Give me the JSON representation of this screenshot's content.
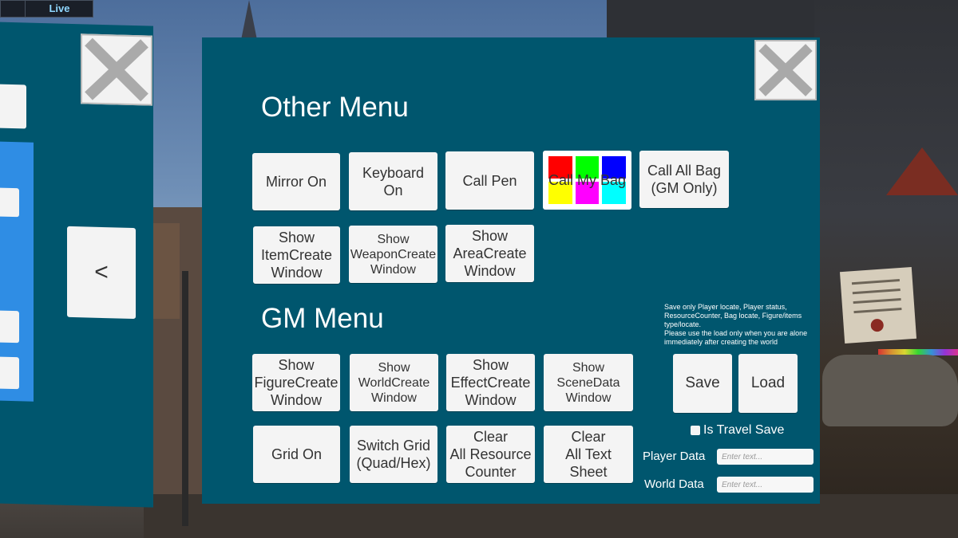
{
  "topbar": {
    "live_label": "Live"
  },
  "left_panel": {
    "arrow_label": "<"
  },
  "main": {
    "close_icon": "close-x-icon",
    "other_menu": {
      "title": "Other Menu",
      "buttons": [
        "Mirror On",
        "Keyboard\nOn",
        "Call Pen",
        "Call My Bag",
        "Call All Bag\n(GM Only)",
        "Show\nItemCreate\nWindow",
        "Show\nWeaponCreate\nWindow",
        "Show\nAreaCreate\nWindow"
      ],
      "bag_colors": [
        "#ff0000",
        "#00ff00",
        "#0000ff",
        "#ffff00",
        "#ff00ff",
        "#00ffff"
      ]
    },
    "gm_menu": {
      "title": "GM Menu",
      "buttons": [
        "Show\nFigureCreate\nWindow",
        "Show\nWorldCreate\nWindow",
        "Show\nEffectCreate\nWindow",
        "Show\nSceneData\nWindow",
        "Grid On",
        "Switch Grid\n(Quad/Hex)",
        "Clear\nAll Resource\nCounter",
        "Clear\nAll Text\nSheet"
      ]
    },
    "save_note": "Save only Player locate, Player status, ResourceCounter, Bag locate, Figure/items type/locate.\nPlease use the load only when you are alone immediately after creating the world",
    "save_label": "Save",
    "load_label": "Load",
    "travel_save_label": "Is Travel Save",
    "player_data_label": "Player Data",
    "world_data_label": "World Data",
    "input_placeholder": "Enter text..."
  }
}
